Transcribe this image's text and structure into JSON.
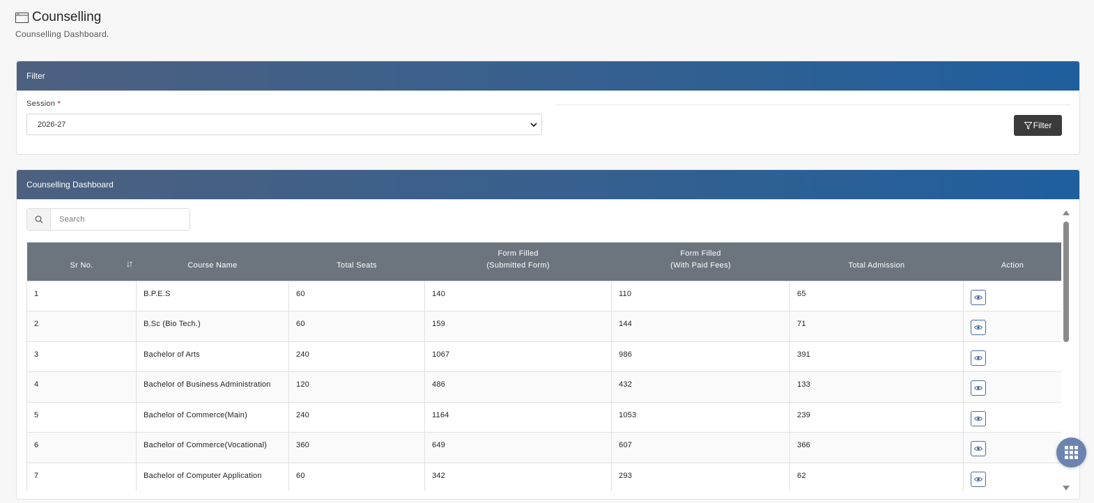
{
  "header": {
    "title": "Counselling",
    "subtitle": "Counselling Dashboard."
  },
  "filter": {
    "header": "Filter",
    "session_label": "Session",
    "required_mark": "*",
    "session_value": "2026-27",
    "filter_button": "Filter"
  },
  "dashboard": {
    "header": "Counselling Dashboard",
    "search_placeholder": "Search",
    "columns": {
      "sr_no": "Sr No.",
      "course_name": "Course Name",
      "total_seats": "Total Seats",
      "form_filled_submitted_1": "Form Filled",
      "form_filled_submitted_2": "(Submitted Form)",
      "form_filled_paid_1": "Form Filled",
      "form_filled_paid_2": "(With Paid Fees)",
      "total_admission": "Total Admission",
      "action": "Action"
    },
    "rows": [
      {
        "sr": "1",
        "course": "B.P.E.S",
        "seats": "60",
        "submitted": "140",
        "paid": "110",
        "admission": "65"
      },
      {
        "sr": "2",
        "course": "B.Sc (Bio Tech.)",
        "seats": "60",
        "submitted": "159",
        "paid": "144",
        "admission": "71"
      },
      {
        "sr": "3",
        "course": "Bachelor of Arts",
        "seats": "240",
        "submitted": "1067",
        "paid": "986",
        "admission": "391"
      },
      {
        "sr": "4",
        "course": "Bachelor of Business Administration",
        "seats": "120",
        "submitted": "486",
        "paid": "432",
        "admission": "133"
      },
      {
        "sr": "5",
        "course": "Bachelor of Commerce(Main)",
        "seats": "240",
        "submitted": "1164",
        "paid": "1053",
        "admission": "239"
      },
      {
        "sr": "6",
        "course": "Bachelor of Commerce(Vocational)",
        "seats": "360",
        "submitted": "649",
        "paid": "607",
        "admission": "366"
      },
      {
        "sr": "7",
        "course": "Bachelor of Computer Application",
        "seats": "60",
        "submitted": "342",
        "paid": "293",
        "admission": "62"
      }
    ]
  },
  "icons": {
    "title": "window-icon",
    "search": "search-icon",
    "filter": "filter-icon",
    "row_action": "eye-icon",
    "fab": "apps-grid-icon"
  },
  "colors": {
    "card_header_start": "#4d6080",
    "card_header_end": "#1f5f9e",
    "table_header": "#6c757d",
    "filter_button": "#3b3b3b",
    "fab": "#6b83b0"
  }
}
